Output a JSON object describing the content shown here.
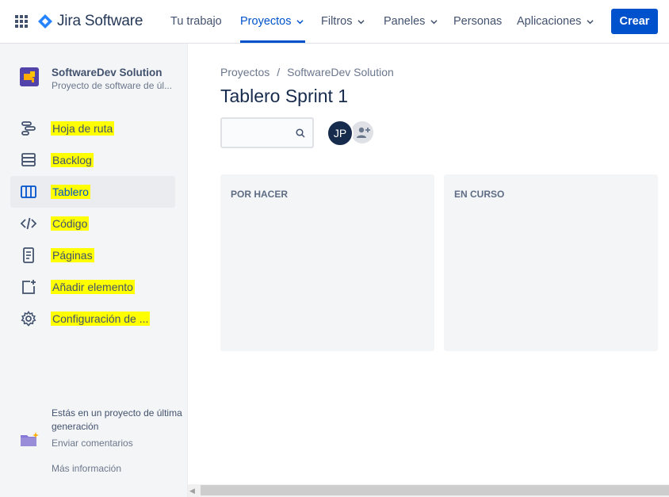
{
  "app": {
    "name": "Jira Software"
  },
  "topnav": {
    "items": [
      {
        "label": "Tu trabajo"
      },
      {
        "label": "Proyectos"
      },
      {
        "label": "Filtros"
      },
      {
        "label": "Paneles"
      },
      {
        "label": "Personas"
      },
      {
        "label": "Aplicaciones"
      }
    ],
    "create_label": "Crear"
  },
  "sidebar": {
    "project_name": "SoftwareDev Solution",
    "project_type": "Proyecto de software de úl...",
    "items": [
      {
        "label": "Hoja de ruta",
        "icon": "roadmap-icon"
      },
      {
        "label": "Backlog",
        "icon": "backlog-icon"
      },
      {
        "label": "Tablero",
        "icon": "board-icon",
        "selected": true
      },
      {
        "label": "Código",
        "icon": "code-icon"
      },
      {
        "label": "Páginas",
        "icon": "pages-icon"
      },
      {
        "label": "Añadir elemento",
        "icon": "add-item-icon"
      },
      {
        "label": "Configuración de ...",
        "icon": "gear-icon"
      }
    ],
    "footer_text": "Estás en un proyecto de última generación",
    "feedback_label": "Enviar comentarios",
    "more_info_label": "Más información"
  },
  "breadcrumb": {
    "items": [
      "Proyectos",
      "SoftwareDev Solution"
    ],
    "separator": "/"
  },
  "page_title": "Tablero Sprint 1",
  "members": {
    "avatar_initials": "JP"
  },
  "board": {
    "columns": [
      {
        "title": "POR HACER"
      },
      {
        "title": "EN CURSO"
      }
    ]
  },
  "colors": {
    "accent": "#0052cc",
    "highlight": "#ffff00",
    "sidebar_bg": "#f4f5f7"
  }
}
